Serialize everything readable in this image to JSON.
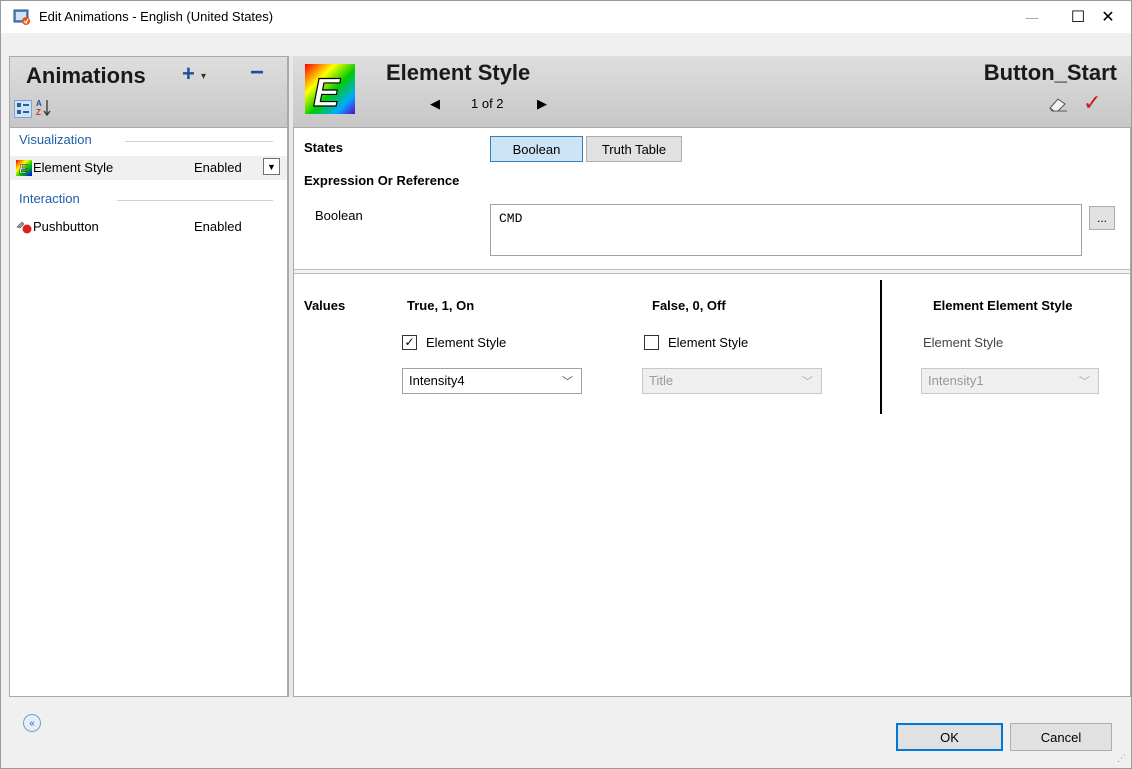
{
  "window": {
    "title": "Edit Animations - English (United States)",
    "controls": {
      "minimize": "—",
      "maximize": "☐",
      "close": "✕"
    }
  },
  "left_panel": {
    "title": "Animations",
    "add_label": "+",
    "add_caret": "▾",
    "remove_label": "−",
    "sort_az_label": "A Z",
    "groups": [
      {
        "label": "Visualization",
        "items": [
          {
            "name": "Element Style",
            "state": "Enabled",
            "icon": "element-style-icon",
            "selected": true
          }
        ]
      },
      {
        "label": "Interaction",
        "items": [
          {
            "name": "Pushbutton",
            "state": "Enabled",
            "icon": "pushbutton-icon",
            "selected": false
          }
        ]
      }
    ]
  },
  "right_panel": {
    "title": "Element Style",
    "pager": {
      "text": "1 of 2",
      "prev": "◀",
      "next": "▶"
    },
    "object_name": "Button_Start",
    "confirm_icon": "✓",
    "states": {
      "label": "States",
      "options": [
        "Boolean",
        "Truth Table"
      ],
      "selected": "Boolean"
    },
    "expression": {
      "section_label": "Expression Or Reference",
      "field_label": "Boolean",
      "value": "CMD",
      "browse_label": "..."
    },
    "values": {
      "label": "Values",
      "true_column": {
        "header": "True, 1, On",
        "checkbox_label": "Element Style",
        "checked": true,
        "combo_value": "Intensity4"
      },
      "false_column": {
        "header": "False, 0, Off",
        "checkbox_label": "Element Style",
        "checked": false,
        "combo_value": "Title"
      },
      "element_column": {
        "header": "Element Element Style",
        "label": "Element Style",
        "combo_value": "Intensity1"
      }
    }
  },
  "footer": {
    "collapse_icon": "«",
    "ok_label": "OK",
    "cancel_label": "Cancel"
  },
  "colors": {
    "accent": "#0078d7",
    "group_text": "#1f5fa8",
    "header_bg": "#d2d2d2",
    "check_red": "#d01818"
  }
}
